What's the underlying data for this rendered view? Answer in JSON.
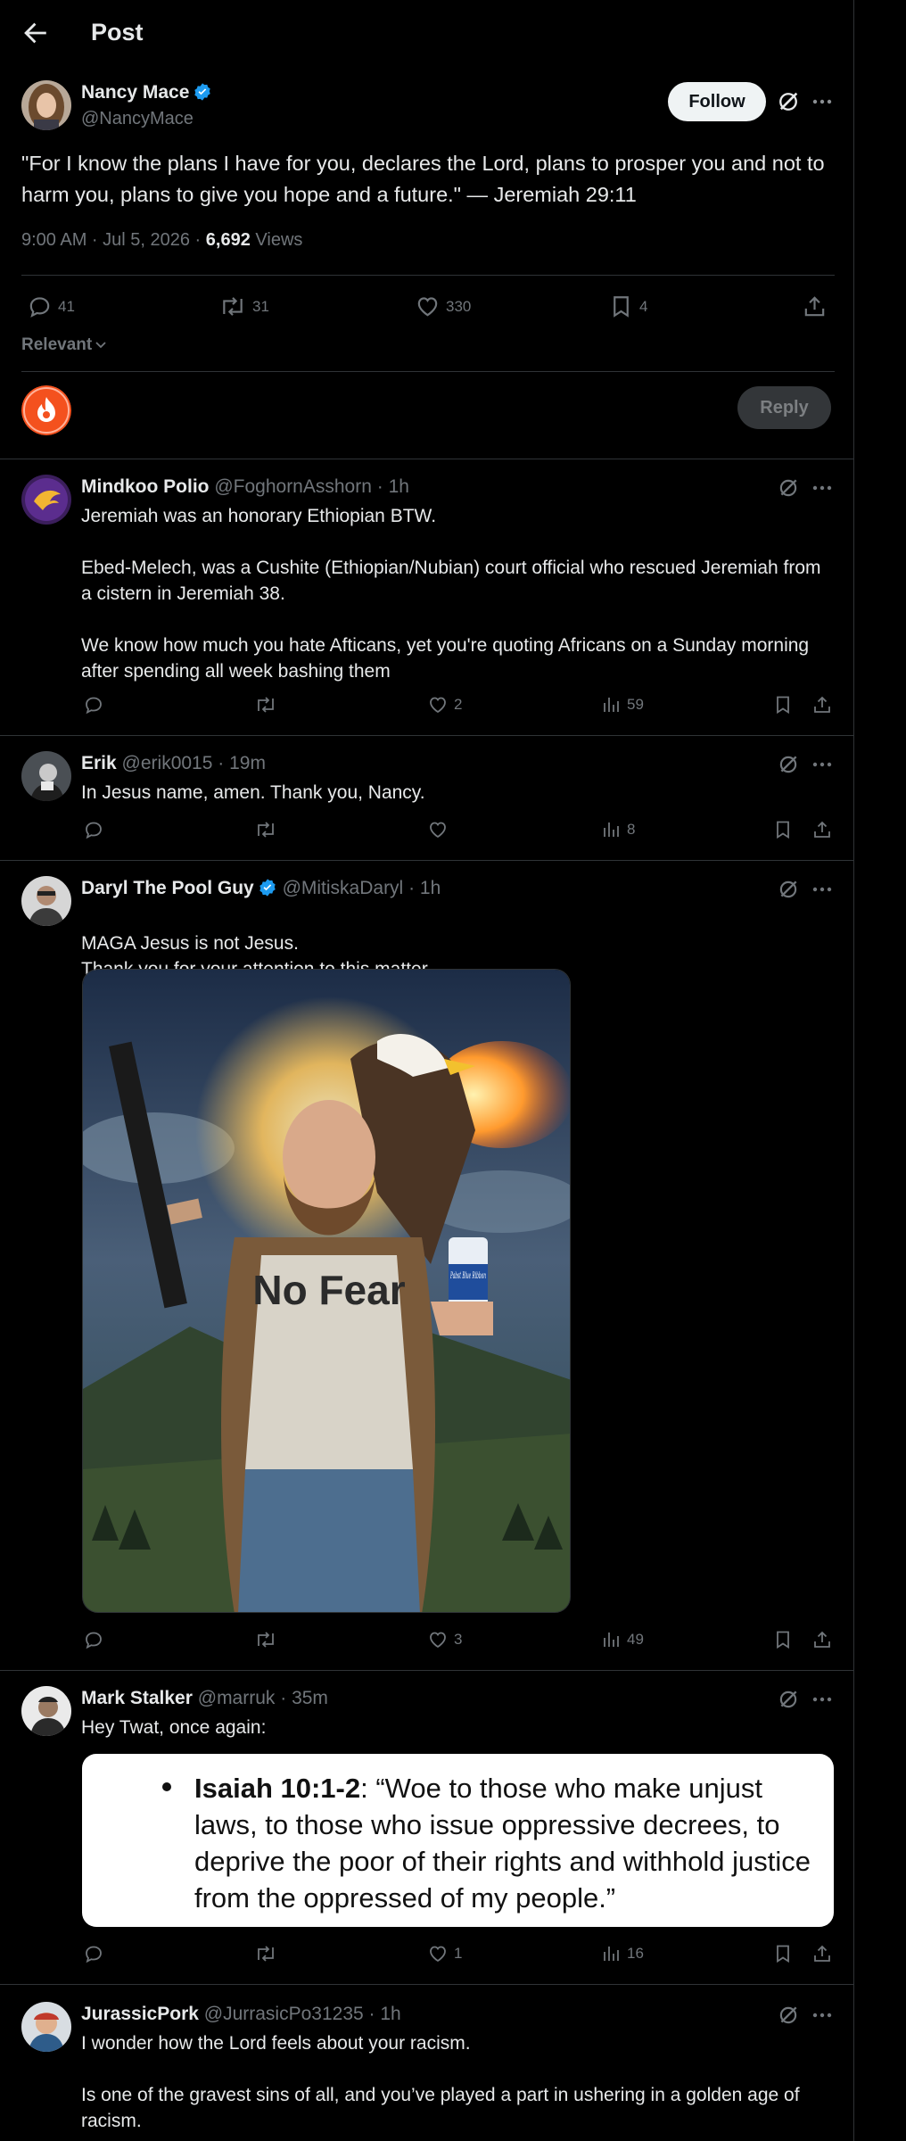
{
  "header": {
    "title": "Post"
  },
  "post": {
    "author_name": "Nancy Mace",
    "author_handle": "@NancyMace",
    "follow_label": "Follow",
    "text": "\"For I know the plans I have for you, declares the Lord, plans to prosper you and not to harm you, plans to give you hope and a future.\" — Jeremiah 29:11",
    "time": "9:00 AM · Jul 5, 2026 · ",
    "views_count": "6,692",
    "views_label": " Views",
    "stats": {
      "replies": "41",
      "reposts": "31",
      "likes": "330",
      "bookmarks": "4"
    },
    "sort_label": "Relevant",
    "reply_label": "Reply"
  },
  "replies": [
    {
      "name": "Mindkoo Polio",
      "handle": "@FoghornAsshorn",
      "time": "· 1h",
      "paragraphs": [
        "Jeremiah was an honorary Ethiopian BTW.",
        "Ebed-Melech, was a Cushite (Ethiopian/Nubian) court official who rescued Jeremiah from a cistern in Jeremiah 38.",
        "We know how much you hate Afticans, yet you're quoting Africans on a Sunday morning after spending all week bashing them"
      ],
      "replies": "",
      "reposts": "",
      "likes": "2",
      "views": "59"
    },
    {
      "name": "Erik",
      "handle": "@erik0015",
      "time": "· 19m",
      "paragraphs": [
        "In Jesus name, amen. Thank you, Nancy."
      ],
      "replies": "",
      "reposts": "",
      "likes": "",
      "views": "8"
    },
    {
      "name": "Daryl The Pool Guy",
      "handle": "@MitiskaDaryl",
      "time": "· 1h",
      "paragraphs": [
        "MAGA Jesus is not Jesus.\nThank you for your attention to this matter."
      ],
      "media_shirt_text": "No Fear",
      "media_can_text": "Pabst Blue Ribbon",
      "replies": "",
      "reposts": "",
      "likes": "3",
      "views": "49"
    },
    {
      "name": "Mark Stalker",
      "handle": "@marruk",
      "time": "· 35m",
      "paragraphs": [
        "Hey Twat, once again:"
      ],
      "quote_ref": "Isaiah 10:1-2",
      "quote_text": ": “Woe to those who make unjust laws, to those who issue oppressive decrees, to deprive the poor of their rights and withhold justice from the oppressed of my people.”",
      "replies": "",
      "reposts": "",
      "likes": "1",
      "views": "16"
    },
    {
      "name": "JurassicPork",
      "handle": "@JurrasicPo31235",
      "time": "· 1h",
      "paragraphs": [
        "I wonder how the Lord feels about your racism.",
        "Is one of the gravest sins of all, and you’ve played a part in ushering in a golden age of racism."
      ]
    }
  ],
  "colors": {
    "background": "#000000",
    "text": "#e7e9ea",
    "muted": "#71767b",
    "border": "#2f3336",
    "verified": "#1d9bf0",
    "brand_orange": "#f4511e"
  }
}
